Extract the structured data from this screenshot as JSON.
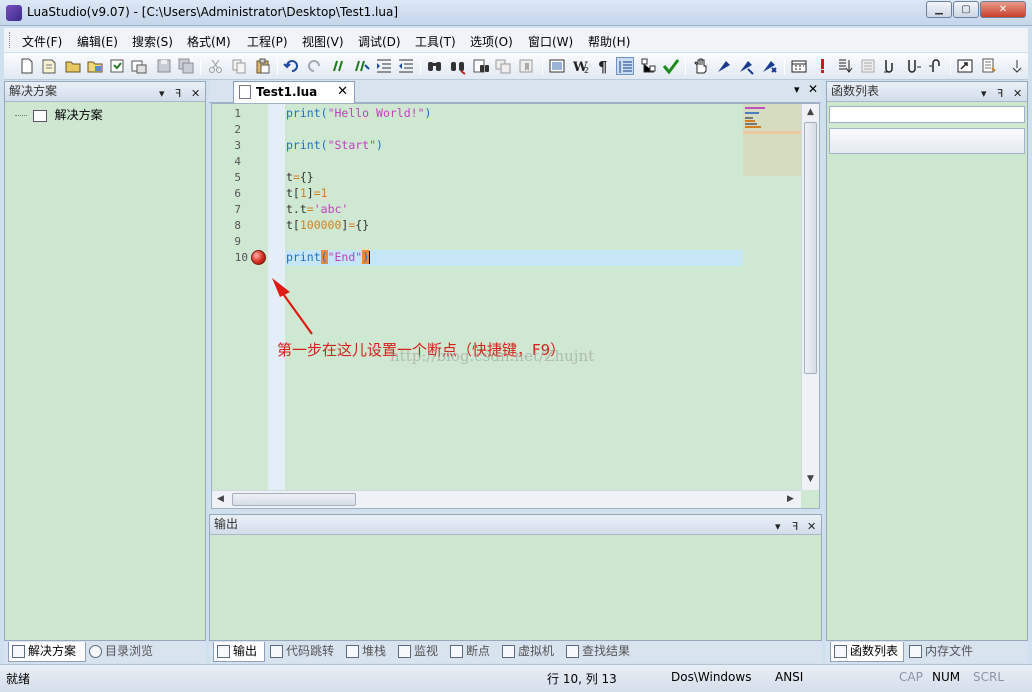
{
  "window": {
    "title": "LuaStudio(v9.07) - [C:\\Users\\Administrator\\Desktop\\Test1.lua]",
    "buttons": {
      "minimize": "▁",
      "maximize": "▢",
      "close": "✕"
    }
  },
  "menu": {
    "items": [
      "文件(F)",
      "编辑(E)",
      "搜索(S)",
      "格式(M)",
      "工程(P)",
      "视图(V)",
      "调试(D)",
      "工具(T)",
      "选项(O)",
      "窗口(W)",
      "帮助(H)"
    ]
  },
  "left_panel": {
    "title": "解决方案",
    "tree_item": "解决方案",
    "tabs": [
      "解决方案",
      "目录浏览"
    ]
  },
  "editor": {
    "tab_label": "Test1.lua",
    "tab_close": "✕",
    "line_numbers": [
      "1",
      "2",
      "3",
      "4",
      "5",
      "6",
      "7",
      "8",
      "9",
      "10"
    ],
    "breakpoint_line": 10
  },
  "annotation": {
    "text": "第一步在这儿设置一个断点（快捷键，F9）",
    "watermark": "http://blog.csdn.net/Zhujnt"
  },
  "output_panel": {
    "title": "输出",
    "tabs": [
      "输出",
      "代码跳转",
      "堆栈",
      "监视",
      "断点",
      "虚拟机",
      "查找结果"
    ]
  },
  "right_panel": {
    "title": "函数列表",
    "tabs": [
      "函数列表",
      "内存文件"
    ]
  },
  "statusbar": {
    "ready": "就绪",
    "position": "行 10, 列 13",
    "line_ending": "Dos\\Windows",
    "encoding": "ANSI",
    "cap": "CAP",
    "num": "NUM",
    "scrl": "SCRL"
  },
  "colors": {
    "panel_bg": "#cde8cf",
    "keyword": "#1e6fc8",
    "string": "#c040c0",
    "number": "#d08020",
    "annotation": "#d4201c"
  }
}
